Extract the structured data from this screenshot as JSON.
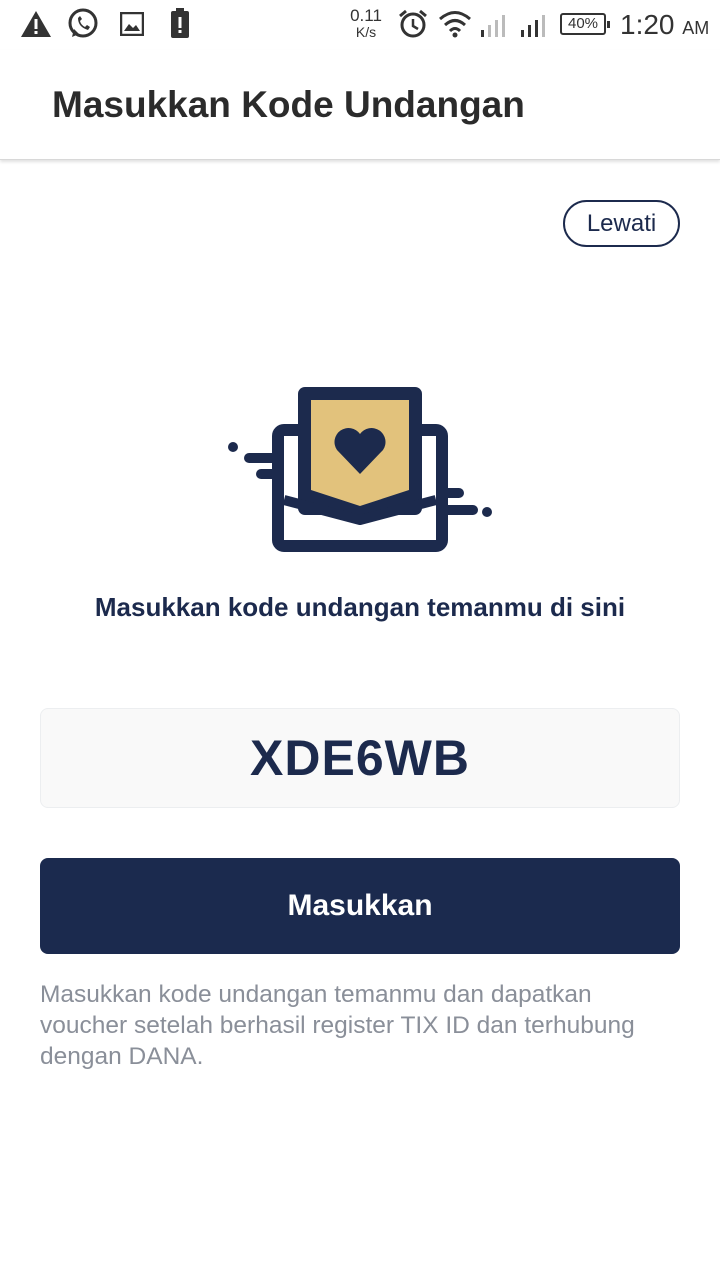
{
  "status_bar": {
    "net_speed_value": "0.11",
    "net_speed_unit": "K/s",
    "battery": "40%",
    "time": "1:20",
    "ampm": "AM",
    "icons": [
      "warning-icon",
      "whatsapp-icon",
      "image-icon",
      "battery-alert-icon",
      "alarm-icon",
      "wifi-icon",
      "signal-icon",
      "signal-icon"
    ]
  },
  "app_bar": {
    "title": "Masukkan Kode Undangan"
  },
  "skip_label": "Lewati",
  "illustration": {
    "name": "envelope-heart-icon",
    "colors": {
      "navy": "#1c2a4d",
      "gold": "#e2c27c"
    }
  },
  "prompt": "Masukkan kode undangan temanmu di sini",
  "code_input": {
    "value": "XDE6WB",
    "placeholder": ""
  },
  "submit_label": "Masukkan",
  "info": "Masukkan kode undangan temanmu dan dapatkan voucher setelah berhasil register TIX ID dan terhubung dengan DANA.",
  "colors": {
    "primary": "#1b2a4e",
    "muted_text": "#8a8f99",
    "field_bg": "#f9f9f9"
  }
}
